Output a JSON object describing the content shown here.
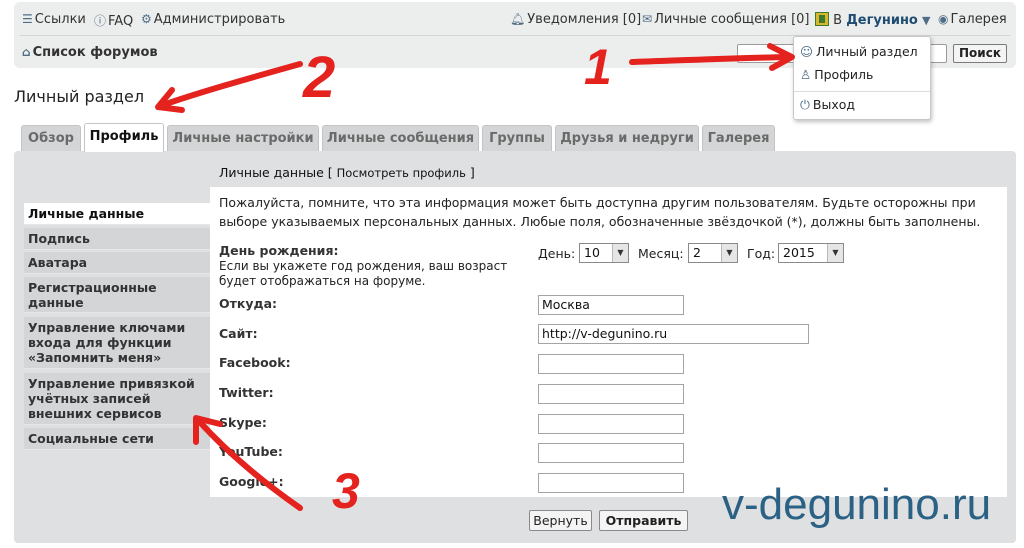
{
  "nav": {
    "links": "Ссылки",
    "faq": "FAQ",
    "admin": "Администрировать",
    "notifications": "Уведомления [0]",
    "messages": "Личные сообщения [0]",
    "user_prefix": "В",
    "user_name": "Дегунино",
    "user_caret": "▼",
    "gallery": "Галерея",
    "forum_list": "Список форумов",
    "search_button": "Поиск"
  },
  "user_dropdown": {
    "items": [
      "Личный раздел",
      "Профиль",
      "Выход"
    ]
  },
  "page_title": "Личный раздел",
  "tabs": [
    {
      "label": "Обзор",
      "active": false
    },
    {
      "label": "Профиль",
      "active": true
    },
    {
      "label": "Личные настройки",
      "active": false
    },
    {
      "label": "Личные сообщения",
      "active": false
    },
    {
      "label": "Группы",
      "active": false
    },
    {
      "label": "Друзья и недруги",
      "active": false
    },
    {
      "label": "Галерея",
      "active": false
    }
  ],
  "section": {
    "heading": "Личные данные",
    "view_profile_link": "Посмотреть профиль"
  },
  "sidebar": {
    "items": [
      "Личные данные",
      "Подпись",
      "Аватара",
      "Регистрационные данные",
      "Управление ключами входа для функции «Запомнить меня»",
      "Управление привязкой учётных записей внешних сервисов",
      "Социальные сети"
    ]
  },
  "form": {
    "notice": "Пожалуйста, помните, что эта информация может быть доступна другим пользователям. Будьте осторожны при выборе указываемых персональных данных. Любые поля, обозначенные звёздочкой (*), должны быть заполнены.",
    "birthday_label": "День рождения:",
    "birthday_hint": "Если вы укажете год рождения, ваш возраст будет отображаться на форуме.",
    "day_label": "День:",
    "day_value": "10",
    "month_label": "Месяц:",
    "month_value": "2",
    "year_label": "Год:",
    "year_value": "2015",
    "location_label": "Откуда:",
    "location_value": "Москва",
    "website_label": "Сайт:",
    "website_value": "http://v-degunino.ru",
    "facebook_label": "Facebook:",
    "twitter_label": "Twitter:",
    "skype_label": "Skype:",
    "youtube_label": "YouTube:",
    "googleplus_label": "Google+:",
    "reset_button": "Вернуть",
    "submit_button": "Отправить"
  },
  "watermark": "v-degunino.ru",
  "annotations": [
    "1",
    "2",
    "3"
  ],
  "colors": {
    "annotation_red": "#e4231f",
    "accent_blue": "#1f4d72",
    "panel_gray": "#dfe0e1"
  }
}
